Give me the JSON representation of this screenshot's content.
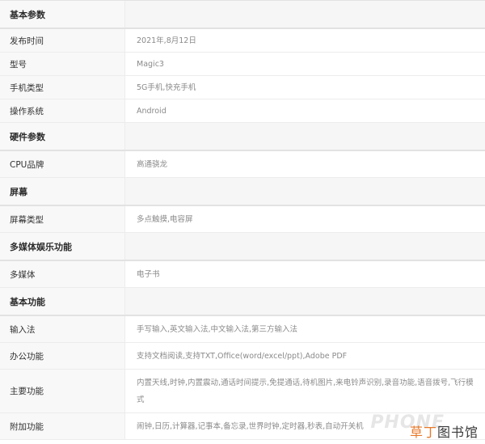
{
  "sections": [
    {
      "title": "基本参数",
      "rows": [
        {
          "label": "发布时间",
          "value": "2021年,8月12日"
        },
        {
          "label": "型号",
          "value": "Magic3"
        },
        {
          "label": "手机类型",
          "value": "5G手机,快充手机"
        },
        {
          "label": "操作系统",
          "value": "Android"
        }
      ]
    },
    {
      "title": "硬件参数",
      "rows": [
        {
          "label": "CPU品牌",
          "value": "高通骁龙"
        }
      ]
    },
    {
      "title": "屏幕",
      "rows": [
        {
          "label": "屏幕类型",
          "value": "多点触摸,电容屏"
        }
      ]
    },
    {
      "title": "多媒体娱乐功能",
      "rows": [
        {
          "label": "多媒体",
          "value": "电子书"
        }
      ]
    },
    {
      "title": "基本功能",
      "rows": [
        {
          "label": "输入法",
          "value": "手写输入,英文输入法,中文输入法,第三方输入法"
        },
        {
          "label": "办公功能",
          "value": "支持文档阅读,支持TXT,Office(word/excel/ppt),Adobe PDF"
        },
        {
          "label": "主要功能",
          "value": "内置天线,时钟,内置震动,通话时间提示,免提通话,待机图片,来电铃声识别,录音功能,语音拨号,飞行模式"
        },
        {
          "label": "附加功能",
          "value": "闹钟,日历,计算器,记事本,备忘录,世界时钟,定时器,秒表,自动开关机"
        }
      ]
    }
  ],
  "watermark": {
    "part_a": "草丁",
    "part_b": "图书馆",
    "background_text": "PHONE"
  }
}
